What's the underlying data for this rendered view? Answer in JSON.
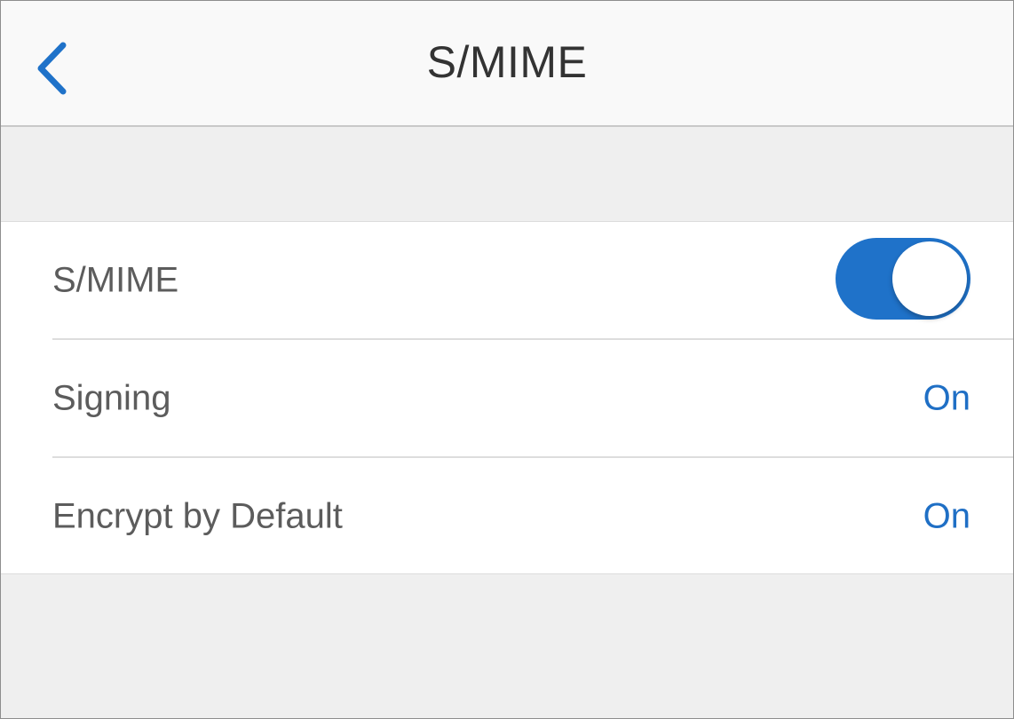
{
  "nav": {
    "title": "S/MIME",
    "back_icon": "chevron-left-icon"
  },
  "settings": {
    "smime": {
      "label": "S/MIME",
      "enabled": true
    },
    "signing": {
      "label": "Signing",
      "value": "On"
    },
    "encrypt_by_default": {
      "label": "Encrypt by Default",
      "value": "On"
    }
  },
  "colors": {
    "accent": "#1f72c9",
    "value_text": "#1f6fc5",
    "background": "#efefef",
    "nav_background": "#f9f9f9"
  }
}
